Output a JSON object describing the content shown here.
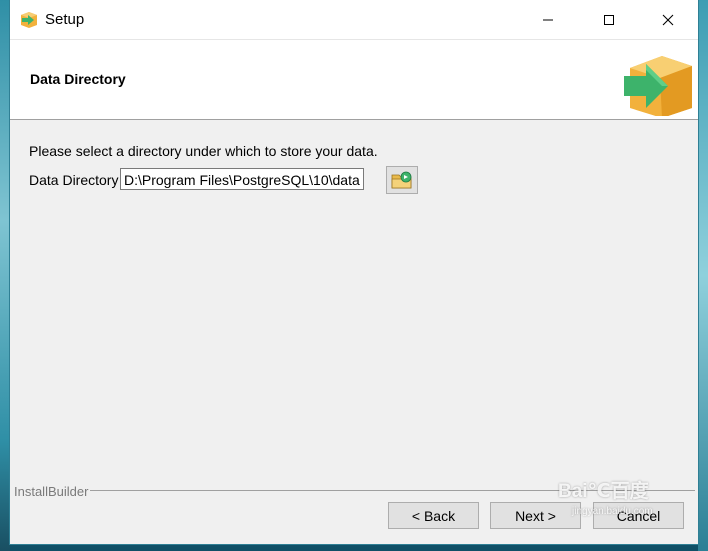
{
  "window": {
    "title": "Setup",
    "controls": {
      "minimize_icon": "minimize-icon",
      "maximize_icon": "maximize-icon",
      "close_icon": "close-icon"
    }
  },
  "header": {
    "title": "Data Directory",
    "logo_icon": "box-arrow-logo"
  },
  "content": {
    "instruction": "Please select a directory under which to store your data.",
    "directory_label": "Data Directory",
    "directory_value": "D:\\Program Files\\PostgreSQL\\10\\data",
    "browse_icon": "folder-browse-icon"
  },
  "footer": {
    "group_label": "InstallBuilder",
    "back_label": "< Back",
    "next_label": "Next >",
    "cancel_label": "Cancel"
  },
  "watermark": {
    "brand": "Bai℃百度",
    "sub": "jingyan.baidu.com"
  },
  "colors": {
    "accent_green": "#3db36b",
    "box_orange": "#f2b13c",
    "desktop_teal": "#1b6f86",
    "dialog_bg": "#f0f0f0"
  }
}
